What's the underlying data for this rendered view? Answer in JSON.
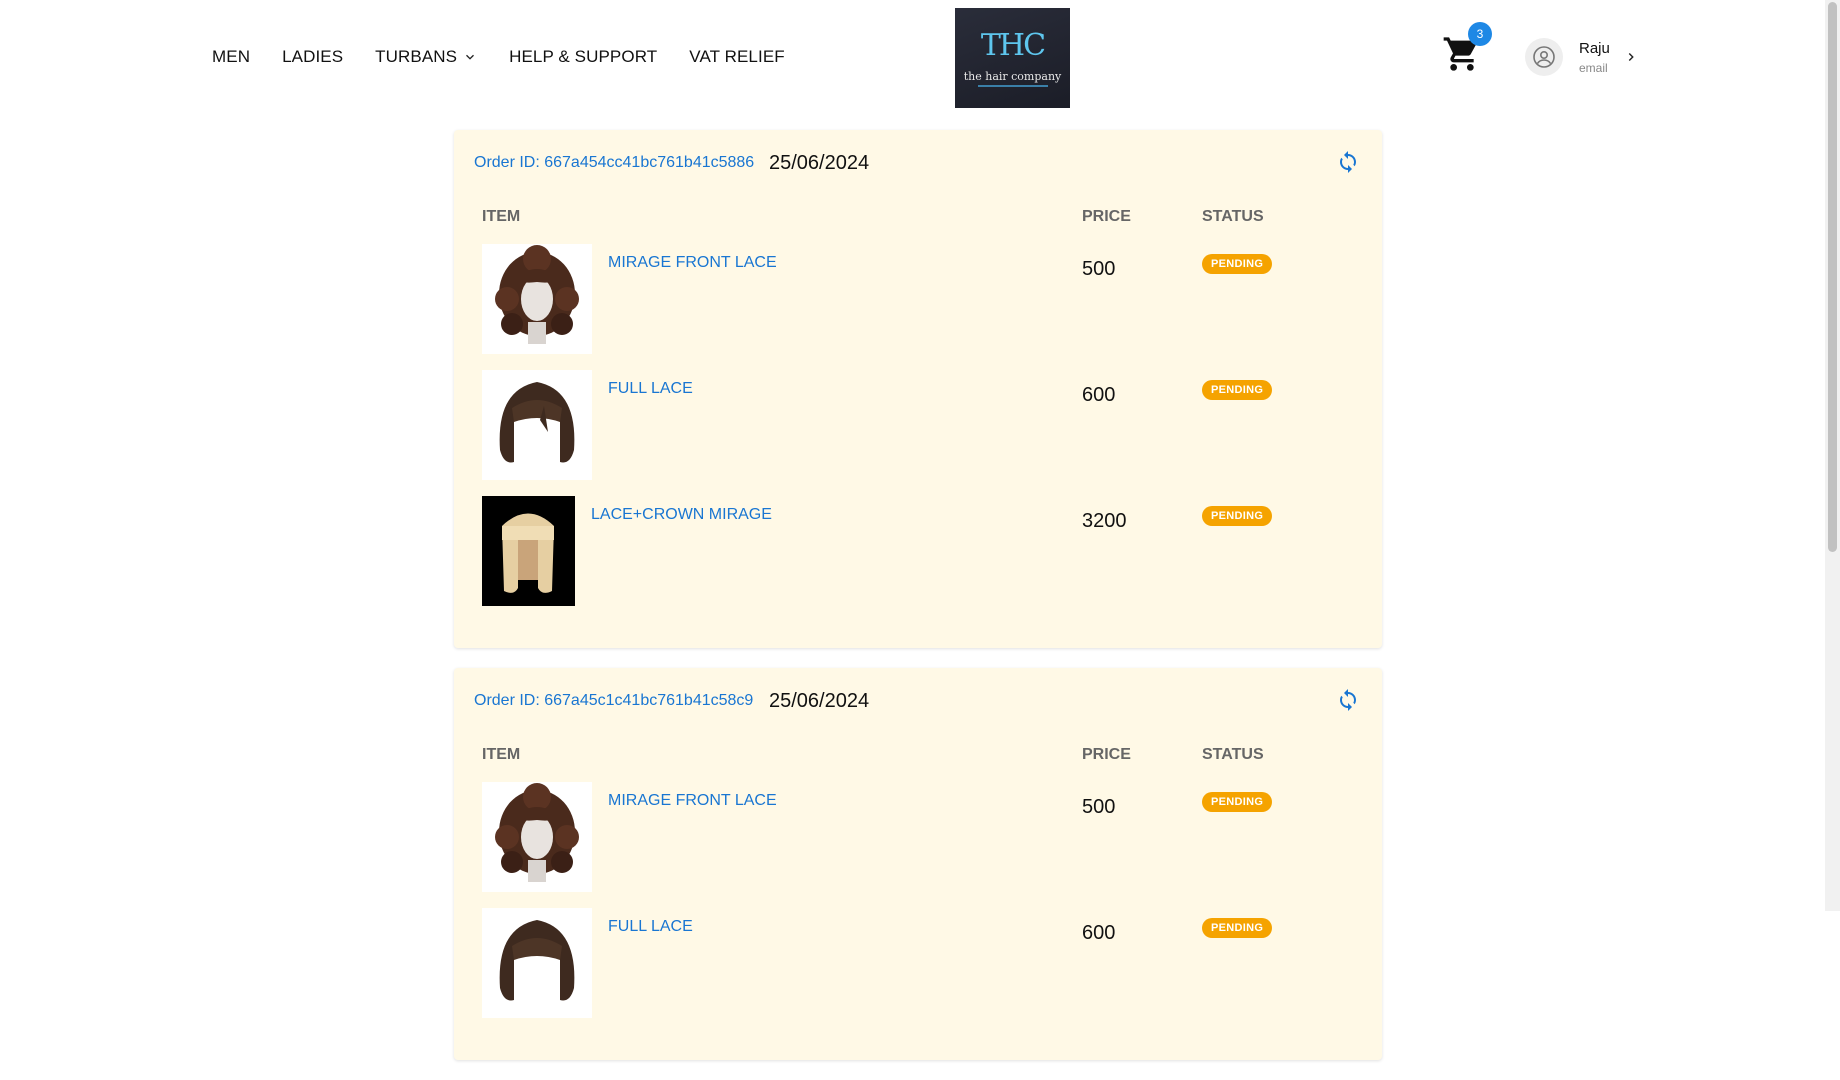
{
  "nav": {
    "items": [
      {
        "label": "MEN"
      },
      {
        "label": "LADIES"
      },
      {
        "label": "TURBANS"
      },
      {
        "label": "HELP & SUPPORT"
      },
      {
        "label": "VAT RELIEF"
      }
    ]
  },
  "logo": {
    "mark": "THC",
    "name": "the hair company"
  },
  "cart": {
    "count": "3",
    "icon": "cart-icon"
  },
  "user": {
    "name": "Raju",
    "email": "email",
    "icon": "user-circle-icon"
  },
  "colors": {
    "accent": "#1976d2",
    "card_bg": "#fff9e6",
    "pending": "#f5a300",
    "badge": "#1e88e5"
  },
  "table_headers": {
    "item": "ITEM",
    "price": "PRICE",
    "status": "STATUS"
  },
  "orders": [
    {
      "id": "Order ID: 667a454cc41bc761b41c5886",
      "date": "25/06/2024",
      "items": [
        {
          "name": "MIRAGE FRONT LACE",
          "price": "500",
          "status": "PENDING"
        },
        {
          "name": "FULL LACE",
          "price": "600",
          "status": "PENDING"
        },
        {
          "name": "LACE+CROWN MIRAGE",
          "price": "3200",
          "status": "PENDING"
        }
      ]
    },
    {
      "id": "Order ID: 667a45c1c41bc761b41c58c9",
      "date": "25/06/2024",
      "items": [
        {
          "name": "MIRAGE FRONT LACE",
          "price": "500",
          "status": "PENDING"
        },
        {
          "name": "FULL LACE",
          "price": "600",
          "status": "PENDING"
        }
      ]
    }
  ]
}
